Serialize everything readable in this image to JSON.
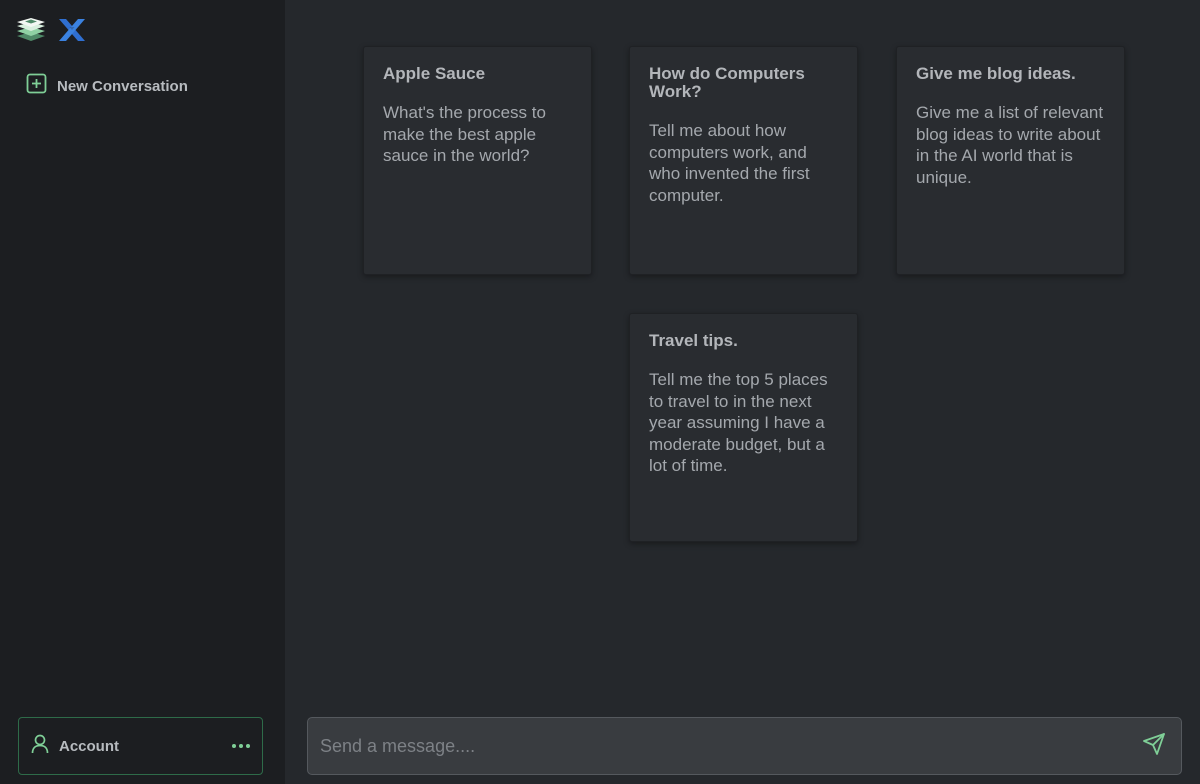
{
  "sidebar": {
    "new_conversation_label": "New Conversation",
    "account_label": "Account"
  },
  "cards": [
    {
      "title": "Apple Sauce",
      "body": "What's the process to make the best apple sauce in the world?"
    },
    {
      "title": "How do Computers Work?",
      "body": "Tell me about how computers work, and who invented the first computer."
    },
    {
      "title": "Give me blog ideas.",
      "body": "Give me a list of relevant blog ideas to write about in the AI world that is unique."
    },
    {
      "title": "Travel tips.",
      "body": "Tell me the top 5 places to travel to in the next year assuming I have a moderate budget, but a lot of time."
    }
  ],
  "composer": {
    "placeholder": "Send a message...."
  },
  "icons": {
    "logo_stack": "stacked-layers-icon",
    "logo_x": "x-logo-icon",
    "new_conversation": "plus-square-icon",
    "account": "user-icon",
    "account_menu": "more-horizontal-icon",
    "send": "send-icon"
  },
  "colors": {
    "accent_green": "#7fcf97",
    "logo_blue": "#2f6fd1",
    "sidebar_bg": "#1c1e21",
    "main_bg": "#25282c",
    "card_bg": "#292c30"
  }
}
